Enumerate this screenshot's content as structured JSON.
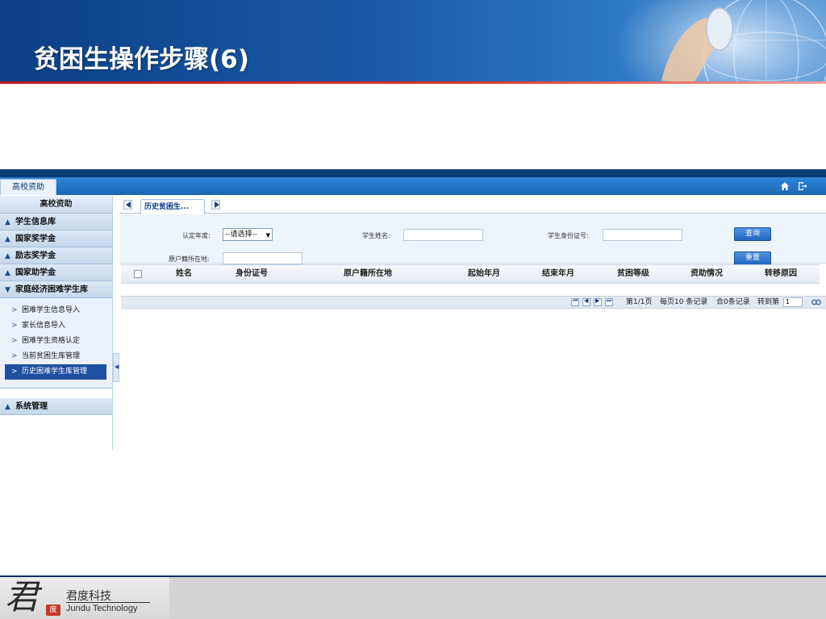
{
  "slide": {
    "title": "贫困生操作步骤(6)"
  },
  "app": {
    "main_tab": "高校资助",
    "icons": {
      "home": "home-icon",
      "exit": "logout-icon"
    }
  },
  "sidebar": {
    "title": "高校资助",
    "sections": [
      {
        "label": "学生信息库",
        "state": "collapsed"
      },
      {
        "label": "国家奖学金",
        "state": "collapsed"
      },
      {
        "label": "励志奖学金",
        "state": "collapsed"
      },
      {
        "label": "国家助学金",
        "state": "collapsed"
      },
      {
        "label": "家庭经济困难学生库",
        "state": "expanded"
      }
    ],
    "sub_items": [
      {
        "label": "困难学生信息导入"
      },
      {
        "label": "家长信息导入"
      },
      {
        "label": "困难学生资格认定"
      },
      {
        "label": "当前贫困生库管理"
      },
      {
        "label": "历史困难学生库管理",
        "active": true
      }
    ],
    "system_section": "系统管理"
  },
  "content": {
    "tab_label": "历史贫困生...",
    "form": {
      "year_label": "认定年度:",
      "year_value": "--请选择--",
      "name_label": "学生姓名:",
      "id_label": "学生身份证号:",
      "origin_label": "原户籍所在地:",
      "query_button": "查询",
      "reset_button": "重置"
    },
    "table": {
      "columns": [
        "姓名",
        "身份证号",
        "原户籍所在地",
        "起始年月",
        "结束年月",
        "贫困等级",
        "资助情况",
        "转移原因"
      ],
      "rows": []
    },
    "pager": {
      "page_info": "第1/1页",
      "per_page": "每页10 条记录",
      "total": "合0条记录",
      "goto_label": "转到第",
      "goto_value": "1"
    }
  },
  "footer": {
    "logo_char": "君",
    "seal_char": "度",
    "company_cn": "君度科技",
    "company_en": "Jundu Technology"
  }
}
